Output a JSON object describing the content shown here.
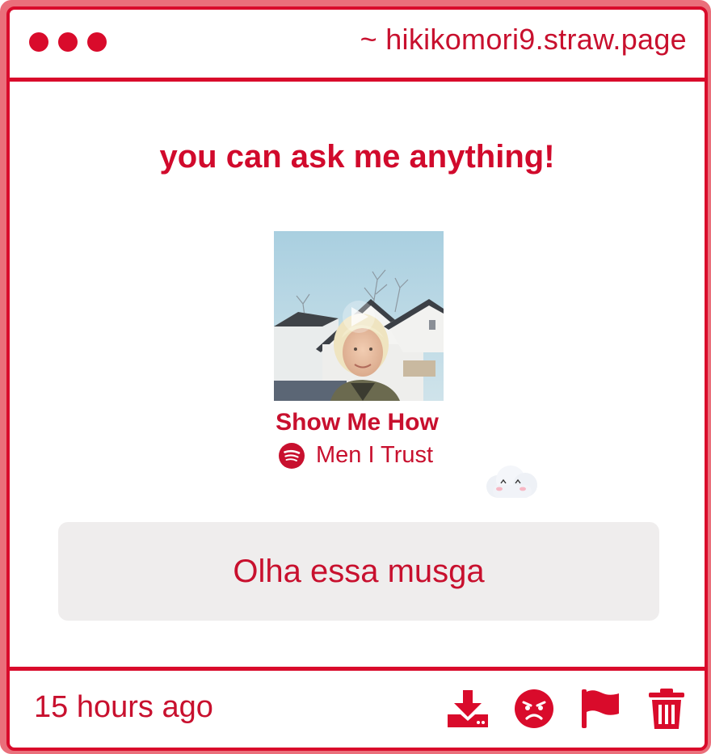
{
  "window": {
    "url": "~ hikikomori9.straw.page"
  },
  "question": "you can ask me anything!",
  "track": {
    "title": "Show Me How",
    "artist": "Men I Trust",
    "platform_icon": "spotify-icon"
  },
  "answer": "Olha essa musga",
  "footer": {
    "time": "15 hours ago",
    "actions": [
      "download-icon",
      "angry-face-icon",
      "flag-icon",
      "trash-icon"
    ]
  },
  "colors": {
    "accent": "#d90b2b",
    "text": "#c8102e",
    "answer_bg": "#efeded"
  }
}
